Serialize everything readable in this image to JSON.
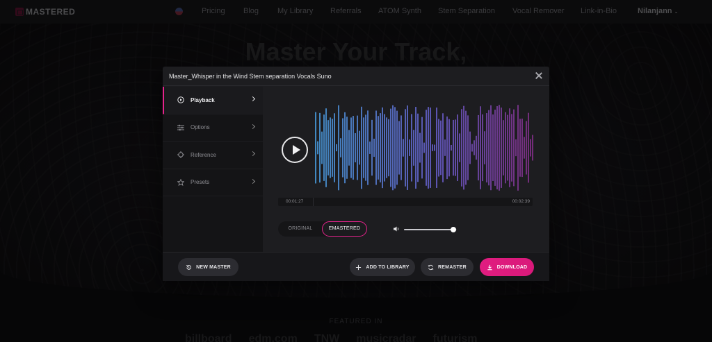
{
  "brand": {
    "logo_text": "MASTERED"
  },
  "nav": {
    "items": [
      "Pricing",
      "Blog",
      "My Library",
      "Referrals",
      "ATOM Synth",
      "Stem Separation",
      "Vocal Remover",
      "Link-in-Bio"
    ],
    "user": "Nilanjann"
  },
  "hero": {
    "title": "Master Your Track,"
  },
  "featured": {
    "label": "FEATURED IN",
    "brands": [
      "billboard",
      "edm.com",
      "TNW",
      "musicradar",
      "futurism"
    ]
  },
  "modal": {
    "title": "Master_Whisper in the Wind Stem separation Vocals Suno",
    "sidebar": [
      {
        "label": "Playback",
        "icon": "play-circle-icon",
        "active": true
      },
      {
        "label": "Options",
        "icon": "sliders-icon",
        "active": false
      },
      {
        "label": "Reference",
        "icon": "crosshair-icon",
        "active": false
      },
      {
        "label": "Presets",
        "icon": "star-icon",
        "active": false
      }
    ],
    "player": {
      "current_time": "00:01:27",
      "total_time": "00:02:39",
      "toggle": {
        "original": "ORIGINAL",
        "emastered": "EMASTERED",
        "selected": "EMASTERED"
      },
      "volume": 0.94
    },
    "footer": {
      "new_master": "NEW MASTER",
      "add_to_library": "ADD TO LIBRARY",
      "remaster": "REMASTER",
      "download": "DOWNLOAD"
    },
    "colors": {
      "accent": "#e5238c",
      "wave_start": "#4aa3e8",
      "wave_end": "#8b2f8f"
    }
  }
}
